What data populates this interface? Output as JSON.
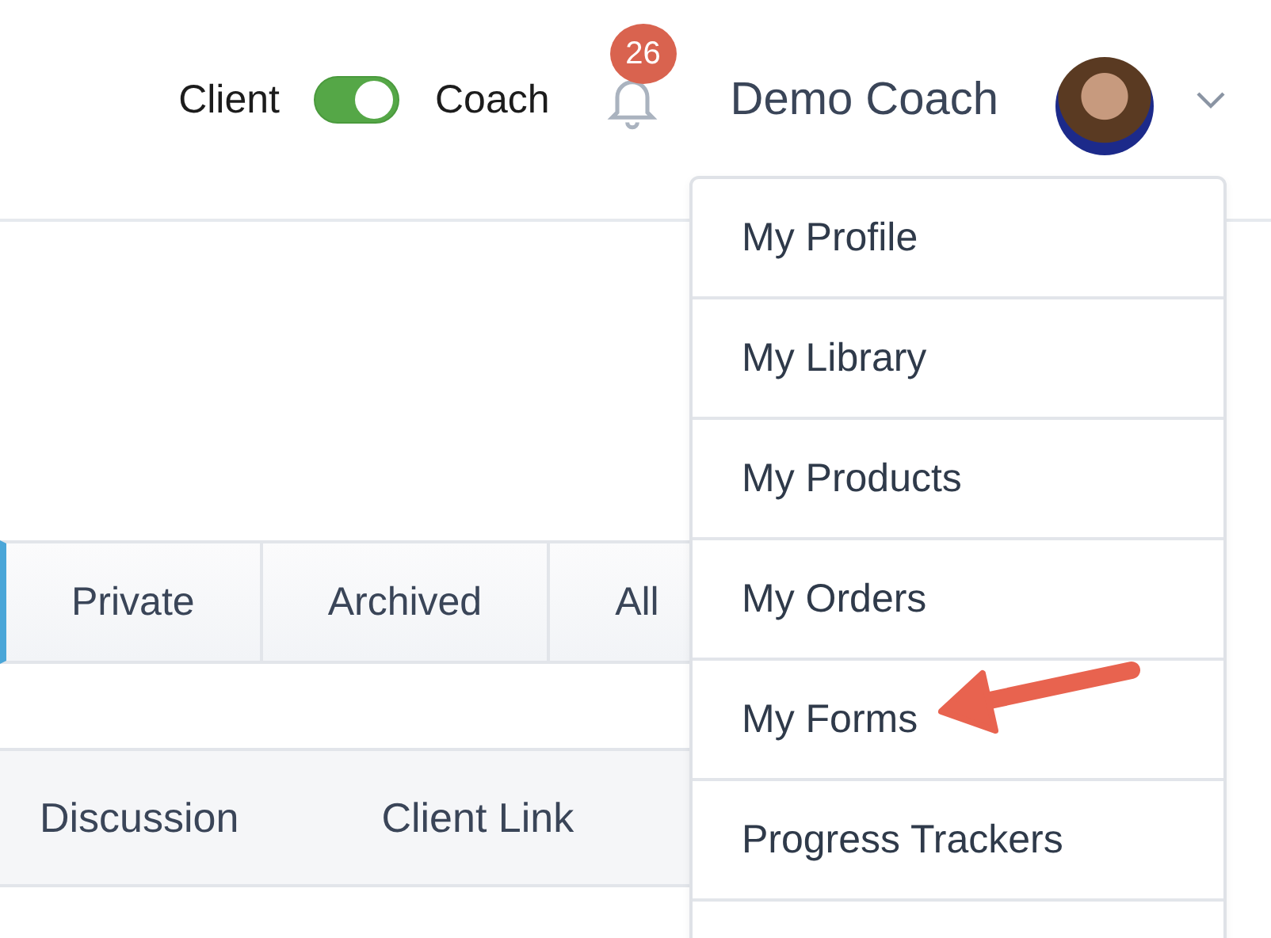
{
  "header": {
    "mode_toggle": {
      "left_label": "Client",
      "right_label": "Coach",
      "on": true
    },
    "notifications": {
      "count": "26"
    },
    "user": {
      "name": "Demo Coach"
    }
  },
  "tabs": [
    {
      "label": "Private",
      "selected": false
    },
    {
      "label": "Archived",
      "selected": false
    },
    {
      "label": "All",
      "selected": false
    }
  ],
  "table": {
    "columns": [
      "Discussion",
      "Client Link"
    ]
  },
  "user_menu": {
    "items": [
      {
        "label": "My Profile"
      },
      {
        "label": "My Library"
      },
      {
        "label": "My Products"
      },
      {
        "label": "My Orders"
      },
      {
        "label": "My Forms",
        "highlighted_by_arrow": true
      },
      {
        "label": "Progress Trackers"
      }
    ]
  }
}
